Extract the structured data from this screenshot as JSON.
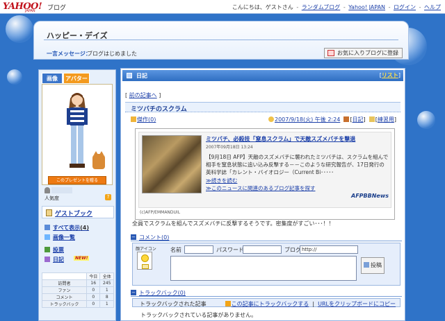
{
  "header": {
    "logo": "YAHOO!",
    "logo_sub": "JAPAN",
    "service": "ブログ",
    "greeting": "こんにちは、ゲストさん",
    "links": [
      "ランダムブログ",
      "Yahoo! JAPAN",
      "ログイン",
      "ヘルプ"
    ]
  },
  "blog": {
    "title": "ハッピー・デイズ",
    "message_label": "一言メッセージ：",
    "message": "ブログはじめました",
    "favorite_button": "お気に入りブログに登録"
  },
  "sidebar": {
    "tabs": [
      "画像",
      "アバター"
    ],
    "present_button": "このプレゼントを贈る",
    "popularity_label": "人気度",
    "guestbook": "ゲストブック",
    "nav": {
      "all": "すべて表示",
      "all_count": "(4)",
      "images": "画像一覧",
      "posts": "投票",
      "diary": "日記",
      "new_badge": "NEW!"
    },
    "stats": {
      "headers": [
        "今日",
        "全体"
      ],
      "rows": [
        {
          "label": "訪問者",
          "today": "16",
          "total": "245"
        },
        {
          "label": "ファン",
          "today": "0",
          "total": "1"
        },
        {
          "label": "コメント",
          "today": "0",
          "total": "8"
        },
        {
          "label": "トラックバック",
          "today": "0",
          "total": "1"
        }
      ]
    }
  },
  "main": {
    "header": "日記",
    "list_link": "リスト",
    "prev_link": "前の記事へ",
    "entry": {
      "title": "ミツバチのスクラム",
      "rating_label": "傑作(0)",
      "datetime": "2007/9/18(火) 午後 2:24",
      "category": "日記",
      "book_label": "練習用"
    },
    "news": {
      "headline": "ミツバチ、必殺技「窒息スクラム」で天敵スズメバチを撃退",
      "date": "2007年09月18日 13:24",
      "body": "【9月18日 AFP】天敵のスズメバチに襲われたミツバチは、スクラムを組んで相手を窒息状態に追い込み反撃する－－このような研究報告が、17日発行の英科学誌「カレント・バイオロジー（Current Bi･････",
      "more": "≫続きを読む",
      "related": "≫このニュースに関連のあるブログ記事を探す",
      "credit": "(c)AFP/EMMANDUIL",
      "logo": "AFPBBNews"
    },
    "entry_body": "全員でスクラムを組んでスズメバチに反撃するそうです。密集度がすごい･･･！！",
    "comments": {
      "title": "コメント(0)",
      "face_label": "顔アイコン",
      "name_label": "名前",
      "password_label": "パスワード",
      "blog_label": "ブログ",
      "blog_placeholder": "http://",
      "submit": "投稿"
    },
    "trackback": {
      "title": "トラックバック(0)",
      "bar_label": "トラックバックされた記事",
      "bar_link": "この記事にトラックバックする",
      "copy_link": "URLをクリップボードにコピー",
      "empty": "トラックバックされている記事がありません。"
    }
  },
  "colors": {
    "background": "#2f73c8",
    "accent": "#f39a1e",
    "link": "#1a3ea8",
    "logo_red": "#c1121c"
  }
}
